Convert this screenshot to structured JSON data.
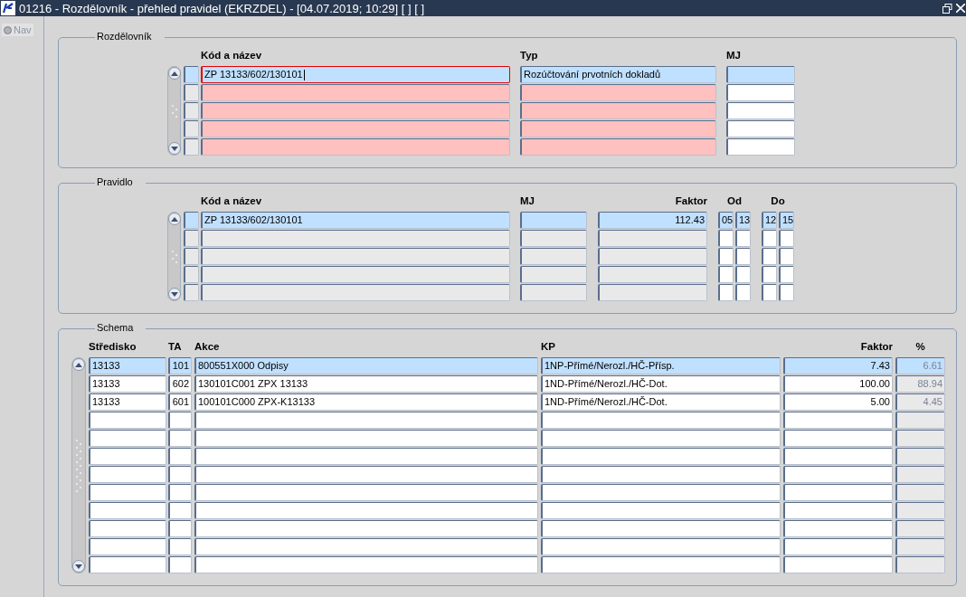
{
  "window": {
    "title": "01216 - Rozdělovník - přehled pravidel (EKRZDEL) - [04.07.2019; 10:29] [ ] [ ]"
  },
  "nav": {
    "label": "Nav",
    "disabled": true
  },
  "sections": [
    {
      "title": "Rozdělovník",
      "record_indicator": true,
      "columns": [
        {
          "label": "Kód a název",
          "kind": "text",
          "required": true,
          "readonly": false
        },
        {
          "label": "Typ",
          "kind": "text",
          "required": true,
          "readonly": false
        },
        {
          "label": "MJ",
          "kind": "text",
          "required": false,
          "readonly": false
        }
      ],
      "rows": [
        {
          "selected": true,
          "focused": true,
          "cells": [
            "ZP 13133/602/130101",
            "Rozúčtování prvotních dokladů",
            null
          ]
        },
        {
          "selected": false,
          "focused": false
        },
        {
          "selected": false,
          "focused": false
        },
        {
          "selected": false,
          "focused": false
        },
        {
          "selected": false,
          "focused": false
        }
      ]
    },
    {
      "title": "Pravidlo",
      "record_indicator": true,
      "columns": [
        {
          "label": "Kód a název",
          "kind": "text",
          "required": false,
          "readonly": true
        },
        {
          "label": "MJ",
          "kind": "text",
          "required": false,
          "readonly": true
        },
        {
          "label": "Faktor",
          "kind": "amount",
          "required": false,
          "readonly": true
        },
        {
          "label": "Od",
          "kind": "split",
          "required": false,
          "readonly": false
        },
        {
          "label": "Do",
          "kind": "split",
          "required": false,
          "readonly": false
        }
      ],
      "rows": [
        {
          "selected": true,
          "focused": false,
          "cells": [
            "ZP 13133/602/130101",
            null,
            "112.43",
            [
              "05",
              "13"
            ],
            [
              "12",
              "15"
            ]
          ]
        },
        {
          "selected": false,
          "focused": false
        },
        {
          "selected": false,
          "focused": false
        },
        {
          "selected": false,
          "focused": false
        },
        {
          "selected": false,
          "focused": false
        }
      ]
    },
    {
      "title": "Schema",
      "record_indicator": false,
      "columns": [
        {
          "label": "Středisko",
          "kind": "text",
          "required": false,
          "readonly": false
        },
        {
          "label": "TA",
          "kind": "code",
          "required": false,
          "readonly": false
        },
        {
          "label": "Akce",
          "kind": "text",
          "required": false,
          "readonly": false
        },
        {
          "label": "KP",
          "kind": "text",
          "required": false,
          "readonly": false
        },
        {
          "label": "Faktor",
          "kind": "amount",
          "required": false,
          "readonly": false
        },
        {
          "label": "%",
          "kind": "share",
          "required": false,
          "readonly": true
        }
      ],
      "rows": [
        {
          "selected": true,
          "focused": false,
          "cells": [
            "13133",
            "101",
            "800551X000 Odpisy",
            "1NP-Přímé/Nerozl./HČ-Přísp.",
            "7.43",
            "6.61"
          ]
        },
        {
          "selected": false,
          "focused": false,
          "cells": [
            "13133",
            "602",
            "130101C001 ZPX 13133",
            "1ND-Přímé/Nerozl./HČ-Dot.",
            "100.00",
            "88.94"
          ]
        },
        {
          "selected": false,
          "focused": false,
          "cells": [
            "13133",
            "601",
            "100101C000 ZPX-K13133",
            "1ND-Přímé/Nerozl./HČ-Dot.",
            "5.00",
            "4.45"
          ]
        },
        {
          "selected": false,
          "focused": false
        },
        {
          "selected": false,
          "focused": false
        },
        {
          "selected": false,
          "focused": false
        },
        {
          "selected": false,
          "focused": false
        },
        {
          "selected": false,
          "focused": false
        },
        {
          "selected": false,
          "focused": false
        },
        {
          "selected": false,
          "focused": false
        },
        {
          "selected": false,
          "focused": false
        },
        {
          "selected": false,
          "focused": false
        }
      ]
    }
  ]
}
